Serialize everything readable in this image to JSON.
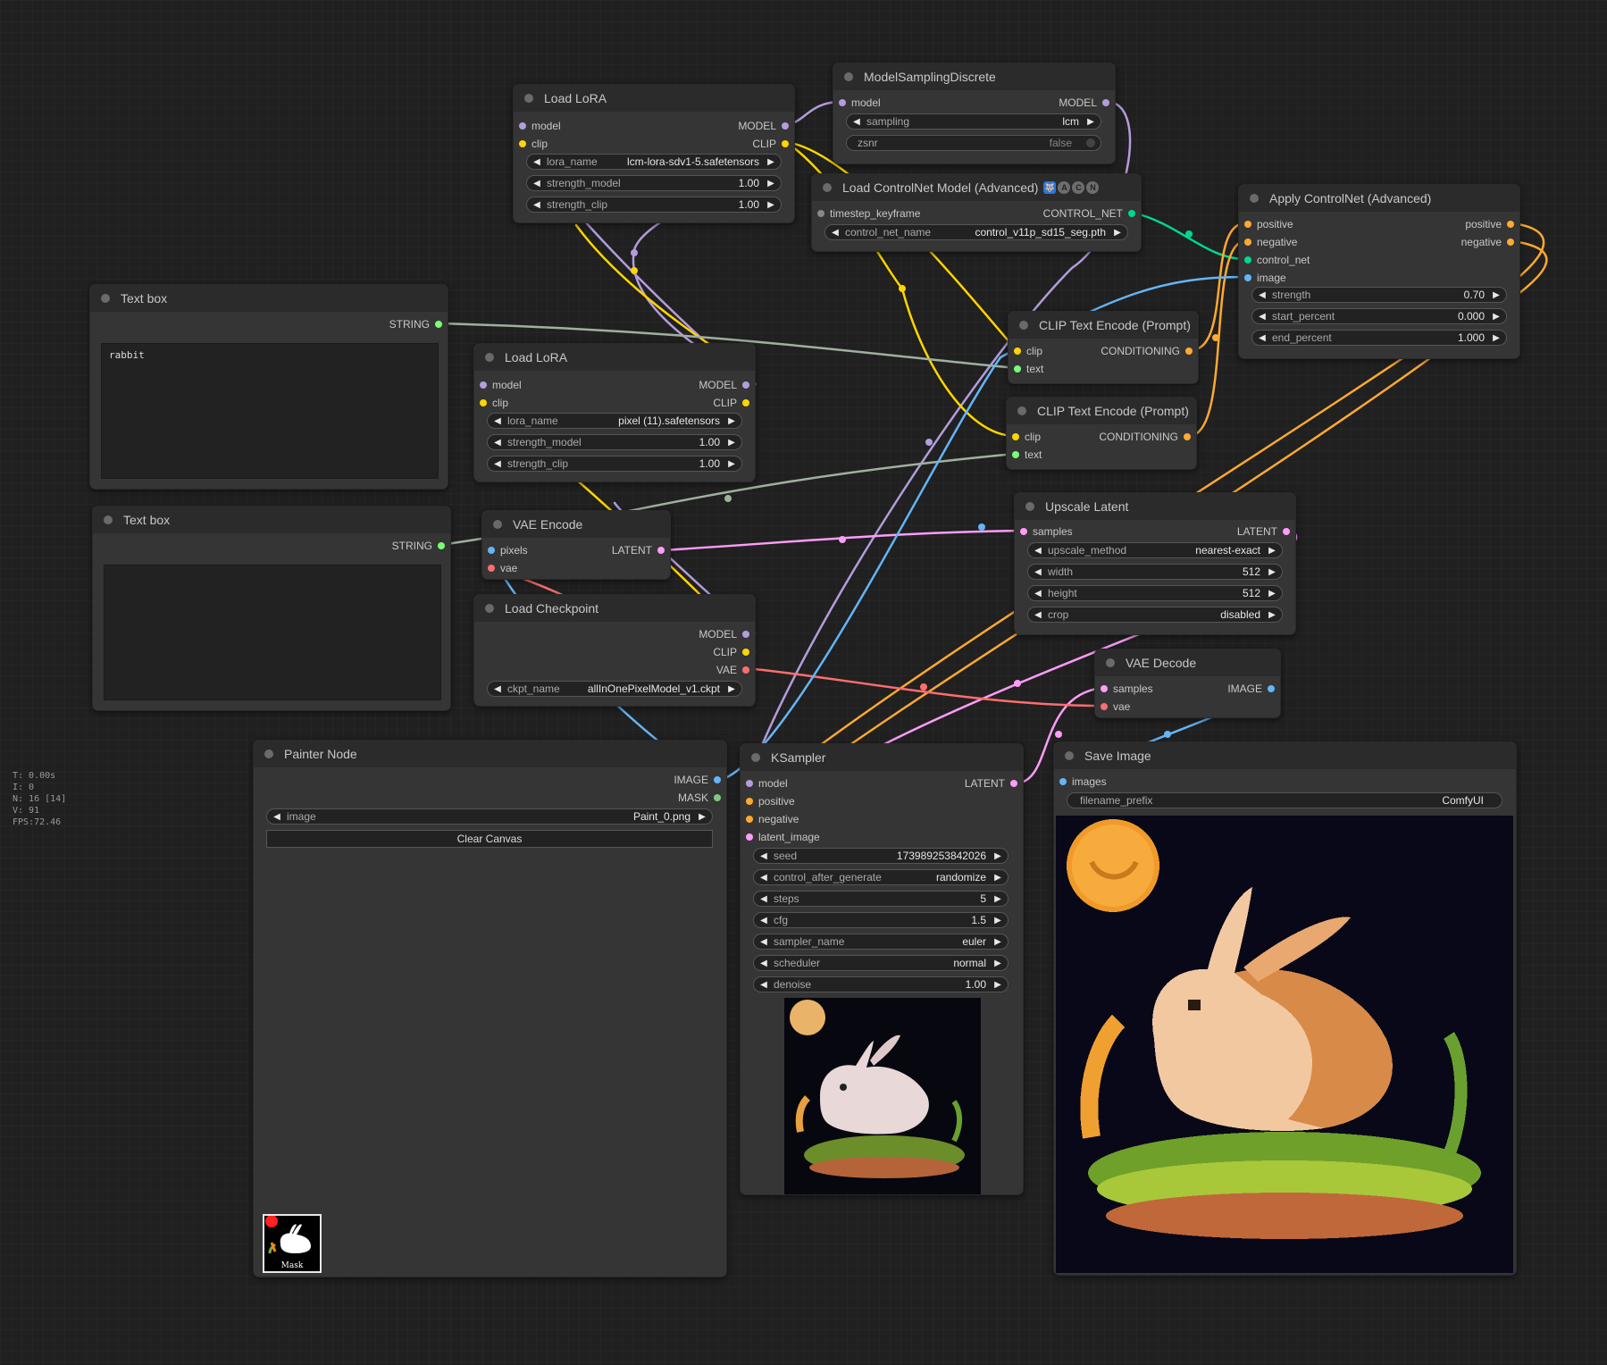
{
  "stats": [
    "T: 0.00s",
    "I: 0",
    "N: 16 [14]",
    "V: 91",
    "FPS:72.46"
  ],
  "colors": {
    "model": "#b39ddb",
    "clip": "#ffd500",
    "conditioning": "#ffa931",
    "control_net": "#00d78d",
    "image": "#64b5f6",
    "latent": "#ff9cf9",
    "vae": "#ff6e6e",
    "string": "#77ff77",
    "mask": "#81c784"
  },
  "nodes": {
    "lora1": {
      "title": "Load LoRA",
      "inputs": [
        "model",
        "clip"
      ],
      "outputs": [
        "MODEL",
        "CLIP"
      ],
      "widgets": [
        {
          "label": "lora_name",
          "value": "lcm-lora-sdv1-5.safetensors"
        },
        {
          "label": "strength_model",
          "value": "1.00"
        },
        {
          "label": "strength_clip",
          "value": "1.00"
        }
      ]
    },
    "msd": {
      "title": "ModelSamplingDiscrete",
      "inputs": [
        "model"
      ],
      "outputs": [
        "MODEL"
      ],
      "widgets": [
        {
          "label": "sampling",
          "value": "lcm"
        },
        {
          "label": "zsnr",
          "value": "false"
        }
      ]
    },
    "cnload": {
      "title": "Load ControlNet Model (Advanced)",
      "badges": [
        "🐺",
        "A",
        "C",
        "N"
      ],
      "inputs": [
        "timestep_keyframe"
      ],
      "outputs": [
        "CONTROL_NET"
      ],
      "widgets": [
        {
          "label": "control_net_name",
          "value": "control_v11p_sd15_seg.pth"
        }
      ]
    },
    "applycn": {
      "title": "Apply ControlNet (Advanced)",
      "inputs": [
        "positive",
        "negative",
        "control_net",
        "image"
      ],
      "outputs": [
        "positive",
        "negative"
      ],
      "widgets": [
        {
          "label": "strength",
          "value": "0.70"
        },
        {
          "label": "start_percent",
          "value": "0.000"
        },
        {
          "label": "end_percent",
          "value": "1.000"
        }
      ]
    },
    "text1": {
      "title": "Text box",
      "output": "STRING",
      "text": "rabbit"
    },
    "text2": {
      "title": "Text box",
      "output": "STRING",
      "text": ""
    },
    "lora2": {
      "title": "Load LoRA",
      "inputs": [
        "model",
        "clip"
      ],
      "outputs": [
        "MODEL",
        "CLIP"
      ],
      "widgets": [
        {
          "label": "lora_name",
          "value": "pixel (11).safetensors"
        },
        {
          "label": "strength_model",
          "value": "1.00"
        },
        {
          "label": "strength_clip",
          "value": "1.00"
        }
      ]
    },
    "clip1": {
      "title": "CLIP Text Encode (Prompt)",
      "inputs": [
        "clip",
        "text"
      ],
      "outputs": [
        "CONDITIONING"
      ]
    },
    "clip2": {
      "title": "CLIP Text Encode (Prompt)",
      "inputs": [
        "clip",
        "text"
      ],
      "outputs": [
        "CONDITIONING"
      ]
    },
    "vaeenc": {
      "title": "VAE Encode",
      "inputs": [
        "pixels",
        "vae"
      ],
      "outputs": [
        "LATENT"
      ]
    },
    "upscale": {
      "title": "Upscale Latent",
      "inputs": [
        "samples"
      ],
      "outputs": [
        "LATENT"
      ],
      "widgets": [
        {
          "label": "upscale_method",
          "value": "nearest-exact"
        },
        {
          "label": "width",
          "value": "512"
        },
        {
          "label": "height",
          "value": "512"
        },
        {
          "label": "crop",
          "value": "disabled"
        }
      ]
    },
    "ckpt": {
      "title": "Load Checkpoint",
      "outputs": [
        "MODEL",
        "CLIP",
        "VAE"
      ],
      "widgets": [
        {
          "label": "ckpt_name",
          "value": "allInOnePixelModel_v1.ckpt"
        }
      ]
    },
    "vaedec": {
      "title": "VAE Decode",
      "inputs": [
        "samples",
        "vae"
      ],
      "outputs": [
        "IMAGE"
      ]
    },
    "painter": {
      "title": "Painter Node",
      "outputs": [
        "IMAGE",
        "MASK"
      ],
      "widgets": [
        {
          "label": "image",
          "value": "Paint_0.png"
        }
      ],
      "button": "Clear Canvas",
      "mask_label": "Mask"
    },
    "ksampler": {
      "title": "KSampler",
      "inputs": [
        "model",
        "positive",
        "negative",
        "latent_image"
      ],
      "outputs": [
        "LATENT"
      ],
      "widgets": [
        {
          "label": "seed",
          "value": "173989253842026"
        },
        {
          "label": "control_after_generate",
          "value": "randomize"
        },
        {
          "label": "steps",
          "value": "5"
        },
        {
          "label": "cfg",
          "value": "1.5"
        },
        {
          "label": "sampler_name",
          "value": "euler"
        },
        {
          "label": "scheduler",
          "value": "normal"
        },
        {
          "label": "denoise",
          "value": "1.00"
        }
      ]
    },
    "save": {
      "title": "Save Image",
      "inputs": [
        "images"
      ],
      "widgets": [
        {
          "label": "filename_prefix",
          "value": "ComfyUI"
        }
      ]
    }
  }
}
